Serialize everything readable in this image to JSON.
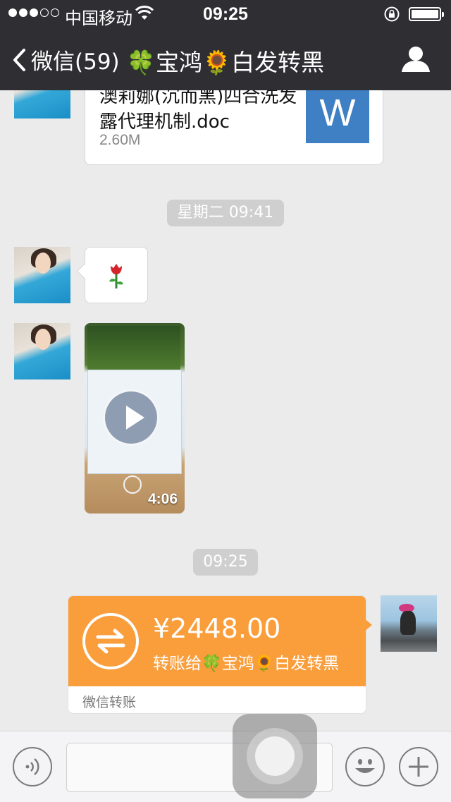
{
  "status_bar": {
    "carrier": "中国移动",
    "time": "09:25",
    "signal_bars_filled": 3,
    "signal_bars_total": 5
  },
  "nav": {
    "back_label": "微信(59)",
    "title": "🍀宝鸿🌻白发转黑"
  },
  "messages": {
    "file": {
      "name": "澳莉娜(沉而黑)四合洗发露代理机制.doc",
      "size": "2.60M",
      "icon_letter": "W"
    },
    "time_divider_1": "星期二 09:41",
    "rose": "🌹",
    "video": {
      "duration": "4:06"
    },
    "time_divider_2": "09:25",
    "transfer": {
      "amount": "¥2448.00",
      "to_text": "转账给🍀宝鸿🌻白发转黑",
      "label": "微信转账"
    }
  },
  "input_bar": {
    "placeholder": ""
  },
  "colors": {
    "nav_bg": "#2e2e33",
    "chat_bg": "#ebebeb",
    "transfer_orange": "#fa9d3b",
    "word_blue": "#3f7fc4"
  }
}
